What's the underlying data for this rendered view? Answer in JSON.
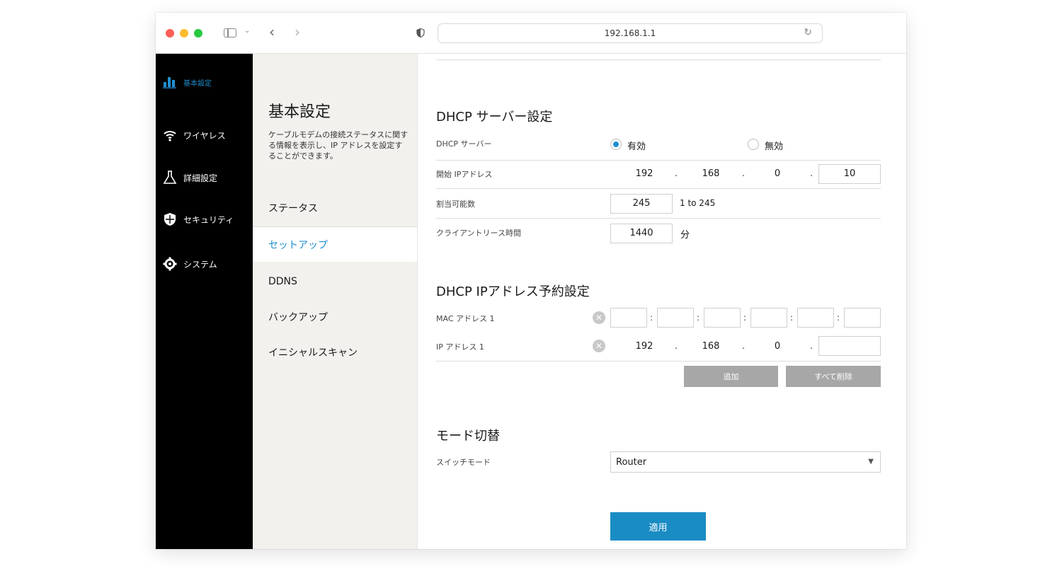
{
  "browser": {
    "url": "192.168.1.1"
  },
  "leftnav": {
    "items": [
      {
        "label": "基本設定",
        "icon": "bar-chart-icon"
      },
      {
        "label": "ワイヤレス",
        "icon": "wifi-icon"
      },
      {
        "label": "詳細設定",
        "icon": "flask-icon"
      },
      {
        "label": "セキュリティ",
        "icon": "shield-icon"
      },
      {
        "label": "システム",
        "icon": "gear-icon"
      }
    ],
    "active_color": "#1f8fd0"
  },
  "submenu": {
    "title": "基本設定",
    "description": "ケーブルモデムの接続ステータスに関する情報を表示し、IP アドレスを設定することができます。",
    "items": [
      "ステータス",
      "セットアップ",
      "DDNS",
      "バックアップ",
      "イニシャルスキャン"
    ],
    "active": "セットアップ"
  },
  "dhcp": {
    "title": "DHCP サーバー設定",
    "server_label": "DHCP サーバー",
    "enabled_label": "有効",
    "disabled_label": "無効",
    "selected": "有効",
    "start_ip_label": "開始 IPアドレス",
    "start_ip": [
      "192",
      "168",
      "0",
      "10"
    ],
    "assignable_label": "割当可能数",
    "assignable_value": "245",
    "assignable_range": "1 to 245",
    "lease_label": "クライアントリース時間",
    "lease_value": "1440",
    "lease_unit": "分"
  },
  "reservation": {
    "title": "DHCP IPアドレス予約設定",
    "mac_label": "MAC アドレス 1",
    "ip_label": "IP アドレス 1",
    "ip_prefix": [
      "192",
      "168",
      "0"
    ],
    "ip_last": "",
    "add_label": "追加",
    "delete_all_label": "すべて削除"
  },
  "mode": {
    "title": "モード切替",
    "switch_label": "スイッチモード",
    "selected": "Router"
  },
  "apply_label": "適用",
  "accent_color": "#1a8cc4"
}
